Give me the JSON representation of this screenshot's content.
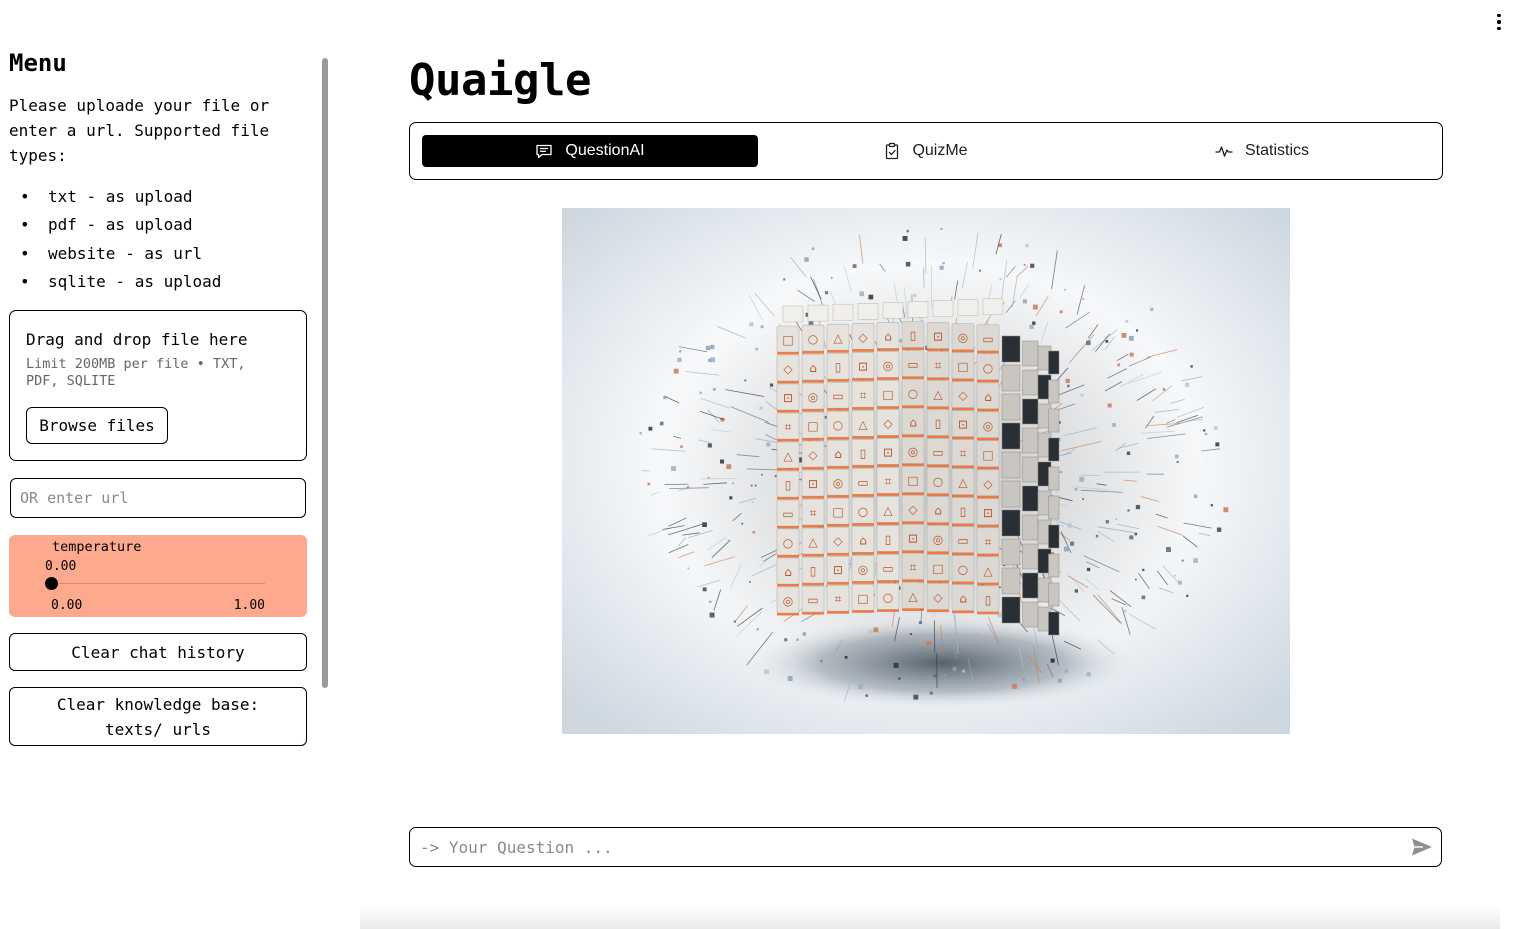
{
  "sidebar": {
    "title": "Menu",
    "intro": "Please uploade your file or enter a url. Supported file types:",
    "file_types": [
      "txt - as upload",
      "pdf - as upload",
      "website - as url",
      "sqlite - as upload"
    ],
    "uploader": {
      "title": "Drag and drop file here",
      "limit": "Limit 200MB per file • TXT, PDF, SQLITE",
      "browse_label": "Browse files"
    },
    "url_input": {
      "placeholder": "OR enter url",
      "value": ""
    },
    "slider": {
      "label": "temperature",
      "value": "0.00",
      "min": "0.00",
      "max": "1.00",
      "fraction": 0,
      "color": "#fda98e"
    },
    "clear_chat_label": "Clear chat history",
    "clear_kb_label": "Clear knowledge base: texts/ urls"
  },
  "main": {
    "title": "Quaigle",
    "tabs": [
      {
        "label": "QuestionAI",
        "icon": "chat-icon",
        "active": true
      },
      {
        "label": "QuizMe",
        "icon": "clipboard-check-icon",
        "active": false
      },
      {
        "label": "Statistics",
        "icon": "activity-icon",
        "active": false
      }
    ],
    "hero_image": "cube-of-icon-blocks-exploding-particles",
    "chat_input": {
      "placeholder": "-> Your Question ...",
      "value": ""
    },
    "send_icon": "send-icon"
  },
  "colors": {
    "accent": "#fda98e",
    "active_tab": "#000000",
    "block_highlight": "#f06a2c"
  }
}
